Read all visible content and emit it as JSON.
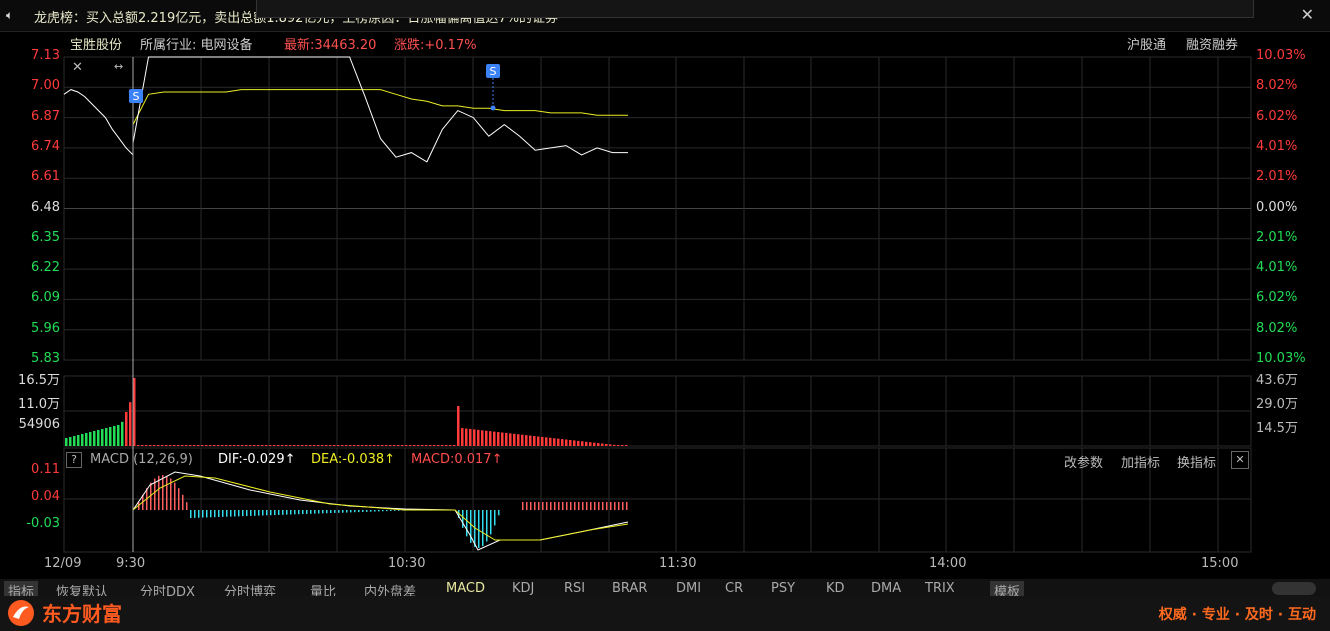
{
  "ticker": {
    "label": "龙虎榜：买入总额2.219亿元，卖出总额1.892亿元，上榜原因：日涨幅偏离值达7%的证券"
  },
  "stock": {
    "name": "宝胜股份",
    "industry": "所属行业: 电网设备",
    "latest": "最新:34463.20",
    "change": "涨跌:+0.17%",
    "link1": "沪股通",
    "link2": "融资融券"
  },
  "price_axis": {
    "left": [
      "7.13",
      "7.00",
      "6.87",
      "6.74",
      "6.61",
      "6.48",
      "6.35",
      "6.22",
      "6.09",
      "5.96",
      "5.83"
    ],
    "right": [
      "10.03%",
      "8.02%",
      "6.02%",
      "4.01%",
      "2.01%",
      "0.00%",
      "2.01%",
      "4.01%",
      "6.02%",
      "8.02%",
      "10.03%"
    ]
  },
  "volume_axis": {
    "left": [
      "16.5万",
      "11.0万",
      "54906"
    ],
    "right": [
      "43.6万",
      "29.0万",
      "14.5万"
    ]
  },
  "macd": {
    "title": "MACD (12,26,9)",
    "dif": "DIF:-0.029↑",
    "dea": "DEA:-0.038↑",
    "val": "MACD:0.017↑",
    "axis": [
      "0.11",
      "0.04",
      "-0.03"
    ],
    "btn1": "改参数",
    "btn2": "加指标",
    "btn3": "换指标"
  },
  "time_axis": [
    "12/09",
    "9:30",
    "10:30",
    "11:30",
    "14:00",
    "15:00"
  ],
  "tabs": [
    "指标",
    "恢复默认",
    "分时DDX",
    "分时博弈",
    "量比",
    "内外盘差",
    "MACD",
    "KDJ",
    "RSI",
    "BRAR",
    "DMI",
    "CR",
    "PSY",
    "KD",
    "DMA",
    "TRIX",
    "模板"
  ],
  "footer": {
    "brand": "东方财富",
    "slogan": "权威 · 专业 · 及时 · 互动"
  },
  "colors": {
    "up": "#ff3b3b",
    "down": "#22dd55",
    "price": "#ffffff",
    "avg": "#eeee22",
    "grid": "#2a2a2a",
    "accent": "#ff5a1f",
    "marker": "#3b82f6"
  },
  "chart_data": {
    "type": "line",
    "title": "宝胜股份",
    "price_series": [
      6.97,
      6.99,
      6.98,
      6.96,
      6.93,
      6.9,
      6.87,
      6.82,
      6.78,
      6.74,
      6.71,
      6.76,
      7.13,
      7.13,
      7.13,
      7.13,
      7.13,
      7.13,
      7.13,
      7.13,
      7.13,
      7.13,
      7.13,
      7.13,
      7.13,
      7.13,
      6.96,
      6.78,
      6.7,
      6.72,
      6.68,
      6.82,
      6.9,
      6.87,
      6.79,
      6.84,
      6.79,
      6.73,
      6.74,
      6.75,
      6.71,
      6.74,
      6.72,
      6.72
    ],
    "avg_series": [
      6.97,
      6.97,
      6.97,
      6.96,
      6.95,
      6.94,
      6.93,
      6.91,
      6.89,
      6.87,
      6.85,
      6.84,
      6.97,
      6.98,
      6.98,
      6.98,
      6.98,
      6.98,
      6.99,
      6.99,
      6.99,
      6.99,
      6.99,
      6.99,
      6.99,
      6.99,
      6.99,
      6.99,
      6.97,
      6.95,
      6.94,
      6.92,
      6.92,
      6.91,
      6.91,
      6.9,
      6.9,
      6.9,
      6.89,
      6.89,
      6.89,
      6.88,
      6.88,
      6.88
    ],
    "ylim": [
      5.83,
      7.13
    ],
    "prev_close": 6.48
  }
}
